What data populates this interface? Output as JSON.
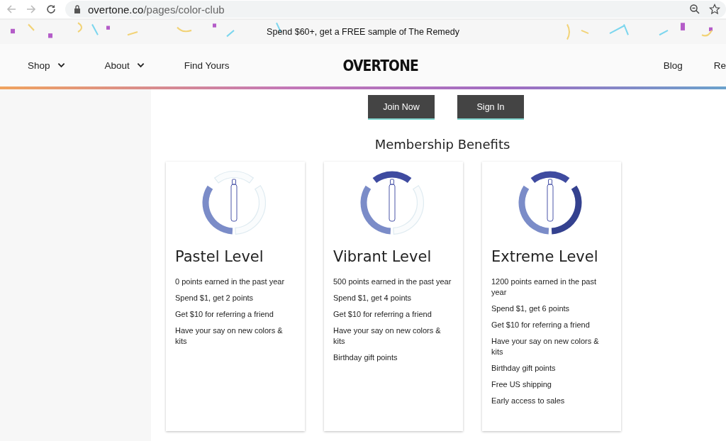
{
  "browser": {
    "url_host": "overtone.co",
    "url_path": "/pages/color-club"
  },
  "banner": {
    "text": "Spend $60+, get a FREE sample of The Remedy"
  },
  "nav": {
    "left": [
      {
        "label": "Shop",
        "dropdown": true
      },
      {
        "label": "About",
        "dropdown": true
      },
      {
        "label": "Find Yours",
        "dropdown": false
      }
    ],
    "logo": "OVERTONE",
    "right": [
      {
        "label": "Blog"
      },
      {
        "label": "Re"
      }
    ]
  },
  "buttons": [
    {
      "label": "Join Now"
    },
    {
      "label": "Sign In"
    }
  ],
  "section_title": "Membership Benefits",
  "levels": [
    {
      "title": "Pastel Level",
      "ring_segments": [
        {
          "filled": true
        },
        {
          "filled": false
        },
        {
          "filled": false
        }
      ],
      "benefits": [
        "0 points earned in the past year",
        "Spend $1, get 2 points",
        "Get $10 for referring a friend",
        "Have your say on new colors & kits"
      ]
    },
    {
      "title": "Vibrant Level",
      "ring_segments": [
        {
          "filled": true
        },
        {
          "filled": true
        },
        {
          "filled": false
        }
      ],
      "benefits": [
        "500 points earned in the past year",
        "Spend $1, get 4 points",
        "Get $10 for referring a friend",
        "Have your say on new colors & kits",
        "Birthday gift points"
      ]
    },
    {
      "title": "Extreme Level",
      "ring_segments": [
        {
          "filled": true
        },
        {
          "filled": true
        },
        {
          "filled": true
        }
      ],
      "benefits": [
        "1200 points earned in the past year",
        "Spend $1, get 6 points",
        "Get $10 for referring a friend",
        "Have your say on new colors & kits",
        "Birthday gift points",
        "Free US shipping",
        "Early access to sales"
      ]
    }
  ]
}
